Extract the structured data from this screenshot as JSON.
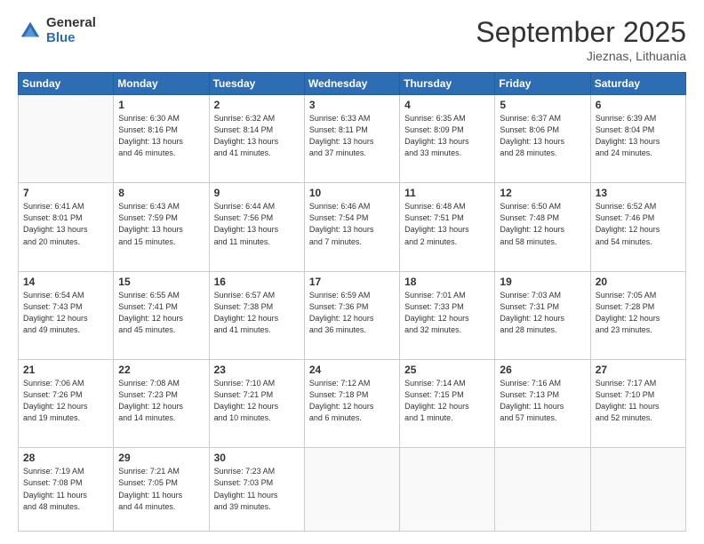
{
  "logo": {
    "general": "General",
    "blue": "Blue"
  },
  "header": {
    "month": "September 2025",
    "location": "Jieznas, Lithuania"
  },
  "weekdays": [
    "Sunday",
    "Monday",
    "Tuesday",
    "Wednesday",
    "Thursday",
    "Friday",
    "Saturday"
  ],
  "weeks": [
    [
      {
        "day": "",
        "info": ""
      },
      {
        "day": "1",
        "info": "Sunrise: 6:30 AM\nSunset: 8:16 PM\nDaylight: 13 hours\nand 46 minutes."
      },
      {
        "day": "2",
        "info": "Sunrise: 6:32 AM\nSunset: 8:14 PM\nDaylight: 13 hours\nand 41 minutes."
      },
      {
        "day": "3",
        "info": "Sunrise: 6:33 AM\nSunset: 8:11 PM\nDaylight: 13 hours\nand 37 minutes."
      },
      {
        "day": "4",
        "info": "Sunrise: 6:35 AM\nSunset: 8:09 PM\nDaylight: 13 hours\nand 33 minutes."
      },
      {
        "day": "5",
        "info": "Sunrise: 6:37 AM\nSunset: 8:06 PM\nDaylight: 13 hours\nand 28 minutes."
      },
      {
        "day": "6",
        "info": "Sunrise: 6:39 AM\nSunset: 8:04 PM\nDaylight: 13 hours\nand 24 minutes."
      }
    ],
    [
      {
        "day": "7",
        "info": "Sunrise: 6:41 AM\nSunset: 8:01 PM\nDaylight: 13 hours\nand 20 minutes."
      },
      {
        "day": "8",
        "info": "Sunrise: 6:43 AM\nSunset: 7:59 PM\nDaylight: 13 hours\nand 15 minutes."
      },
      {
        "day": "9",
        "info": "Sunrise: 6:44 AM\nSunset: 7:56 PM\nDaylight: 13 hours\nand 11 minutes."
      },
      {
        "day": "10",
        "info": "Sunrise: 6:46 AM\nSunset: 7:54 PM\nDaylight: 13 hours\nand 7 minutes."
      },
      {
        "day": "11",
        "info": "Sunrise: 6:48 AM\nSunset: 7:51 PM\nDaylight: 13 hours\nand 2 minutes."
      },
      {
        "day": "12",
        "info": "Sunrise: 6:50 AM\nSunset: 7:48 PM\nDaylight: 12 hours\nand 58 minutes."
      },
      {
        "day": "13",
        "info": "Sunrise: 6:52 AM\nSunset: 7:46 PM\nDaylight: 12 hours\nand 54 minutes."
      }
    ],
    [
      {
        "day": "14",
        "info": "Sunrise: 6:54 AM\nSunset: 7:43 PM\nDaylight: 12 hours\nand 49 minutes."
      },
      {
        "day": "15",
        "info": "Sunrise: 6:55 AM\nSunset: 7:41 PM\nDaylight: 12 hours\nand 45 minutes."
      },
      {
        "day": "16",
        "info": "Sunrise: 6:57 AM\nSunset: 7:38 PM\nDaylight: 12 hours\nand 41 minutes."
      },
      {
        "day": "17",
        "info": "Sunrise: 6:59 AM\nSunset: 7:36 PM\nDaylight: 12 hours\nand 36 minutes."
      },
      {
        "day": "18",
        "info": "Sunrise: 7:01 AM\nSunset: 7:33 PM\nDaylight: 12 hours\nand 32 minutes."
      },
      {
        "day": "19",
        "info": "Sunrise: 7:03 AM\nSunset: 7:31 PM\nDaylight: 12 hours\nand 28 minutes."
      },
      {
        "day": "20",
        "info": "Sunrise: 7:05 AM\nSunset: 7:28 PM\nDaylight: 12 hours\nand 23 minutes."
      }
    ],
    [
      {
        "day": "21",
        "info": "Sunrise: 7:06 AM\nSunset: 7:26 PM\nDaylight: 12 hours\nand 19 minutes."
      },
      {
        "day": "22",
        "info": "Sunrise: 7:08 AM\nSunset: 7:23 PM\nDaylight: 12 hours\nand 14 minutes."
      },
      {
        "day": "23",
        "info": "Sunrise: 7:10 AM\nSunset: 7:21 PM\nDaylight: 12 hours\nand 10 minutes."
      },
      {
        "day": "24",
        "info": "Sunrise: 7:12 AM\nSunset: 7:18 PM\nDaylight: 12 hours\nand 6 minutes."
      },
      {
        "day": "25",
        "info": "Sunrise: 7:14 AM\nSunset: 7:15 PM\nDaylight: 12 hours\nand 1 minute."
      },
      {
        "day": "26",
        "info": "Sunrise: 7:16 AM\nSunset: 7:13 PM\nDaylight: 11 hours\nand 57 minutes."
      },
      {
        "day": "27",
        "info": "Sunrise: 7:17 AM\nSunset: 7:10 PM\nDaylight: 11 hours\nand 52 minutes."
      }
    ],
    [
      {
        "day": "28",
        "info": "Sunrise: 7:19 AM\nSunset: 7:08 PM\nDaylight: 11 hours\nand 48 minutes."
      },
      {
        "day": "29",
        "info": "Sunrise: 7:21 AM\nSunset: 7:05 PM\nDaylight: 11 hours\nand 44 minutes."
      },
      {
        "day": "30",
        "info": "Sunrise: 7:23 AM\nSunset: 7:03 PM\nDaylight: 11 hours\nand 39 minutes."
      },
      {
        "day": "",
        "info": ""
      },
      {
        "day": "",
        "info": ""
      },
      {
        "day": "",
        "info": ""
      },
      {
        "day": "",
        "info": ""
      }
    ]
  ]
}
